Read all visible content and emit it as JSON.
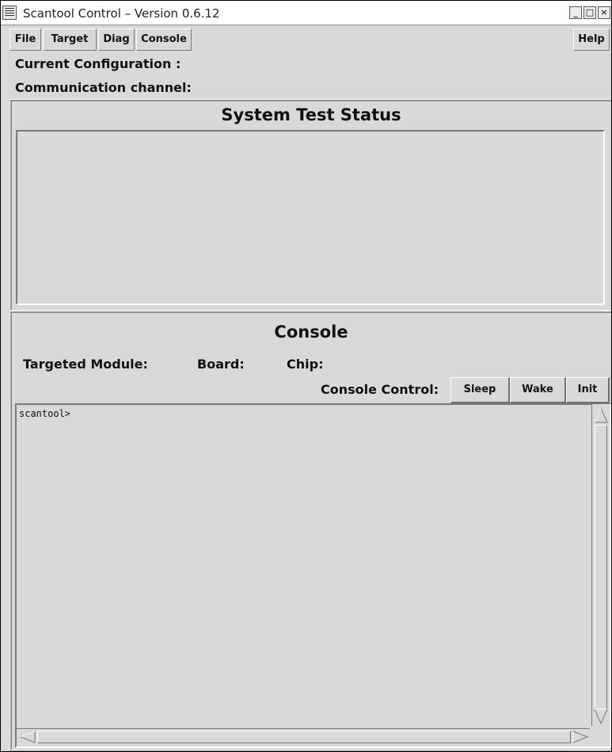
{
  "window": {
    "title": "Scantool Control –  Version 0.6.12",
    "controls": {
      "minimize": "_",
      "maximize": "□",
      "close": "×"
    }
  },
  "menubar": {
    "items": [
      {
        "label": "File"
      },
      {
        "label": "Target"
      },
      {
        "label": "Diag"
      },
      {
        "label": "Console"
      }
    ],
    "help_label": "Help"
  },
  "info": {
    "current_configuration": "Current Configuration :",
    "communication_channel": "Communication channel:"
  },
  "system_test": {
    "title": "System Test Status"
  },
  "console": {
    "title": "Console",
    "targeted_module": "Targeted Module:",
    "board": "Board:",
    "chip": "Chip:",
    "control_label": "Console Control:",
    "buttons": {
      "sleep": "Sleep",
      "wake": "Wake",
      "init": "Init"
    },
    "output": "scantool>"
  }
}
